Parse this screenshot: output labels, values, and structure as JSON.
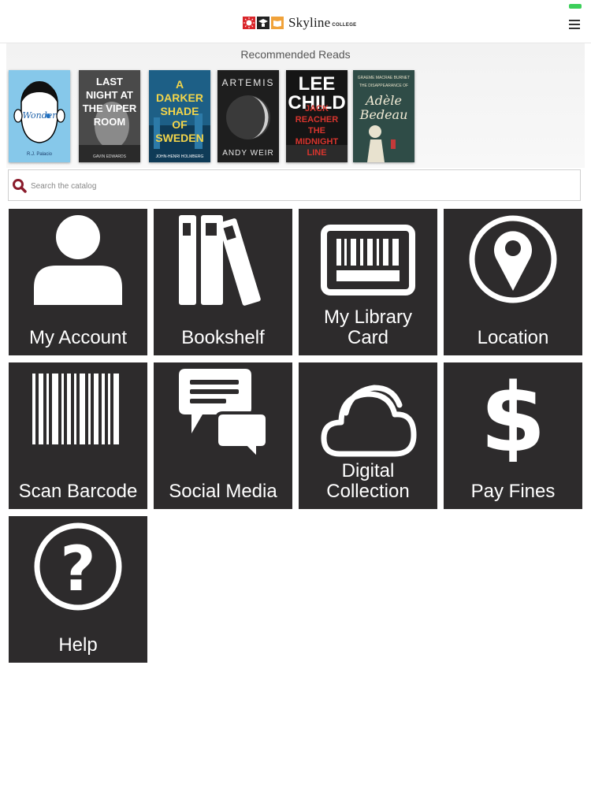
{
  "header": {
    "brand": "Skyline",
    "brand_sub": "COLLEGE"
  },
  "recommended": {
    "title": "Recommended Reads",
    "books": [
      {
        "title": "Wonder",
        "author": "R.J. Palacio"
      },
      {
        "title": "LAST NIGHT AT THE VIPER ROOM",
        "author": "GAVIN EDWARDS"
      },
      {
        "title": "A DARKER SHADE OF SWEDEN",
        "author": "JOHN-HENRI HOLMBERG"
      },
      {
        "title": "ARTEMIS",
        "author": "ANDY WEIR"
      },
      {
        "title": "JACK REACHER THE MIDNIGHT LINE",
        "author": "LEE CHILD"
      },
      {
        "title": "Adèle Bedeau",
        "subtitle": "THE DISAPPEARANCE OF",
        "author": "GRAEME MACRAE BURNET"
      }
    ]
  },
  "search": {
    "placeholder": "Search the catalog",
    "value": ""
  },
  "tiles": [
    {
      "id": "my-account",
      "label": "My Account",
      "icon": "person-icon"
    },
    {
      "id": "bookshelf",
      "label": "Bookshelf",
      "icon": "books-icon"
    },
    {
      "id": "library-card",
      "label": "My Library Card",
      "icon": "library-card-icon"
    },
    {
      "id": "location",
      "label": "Location",
      "icon": "map-pin-icon"
    },
    {
      "id": "scan-barcode",
      "label": "Scan Barcode",
      "icon": "barcode-icon"
    },
    {
      "id": "social-media",
      "label": "Social Media",
      "icon": "chat-bubbles-icon"
    },
    {
      "id": "digital-collection",
      "label": "Digital Collection",
      "icon": "cloud-icon"
    },
    {
      "id": "pay-fines",
      "label": "Pay Fines",
      "icon": "dollar-icon"
    },
    {
      "id": "help",
      "label": "Help",
      "icon": "question-icon"
    }
  ],
  "colors": {
    "tile_bg": "#2d2b2c",
    "tile_fg": "#ffffff",
    "search_icon": "#8a1c2c",
    "status_battery": "#3ccf5a"
  }
}
